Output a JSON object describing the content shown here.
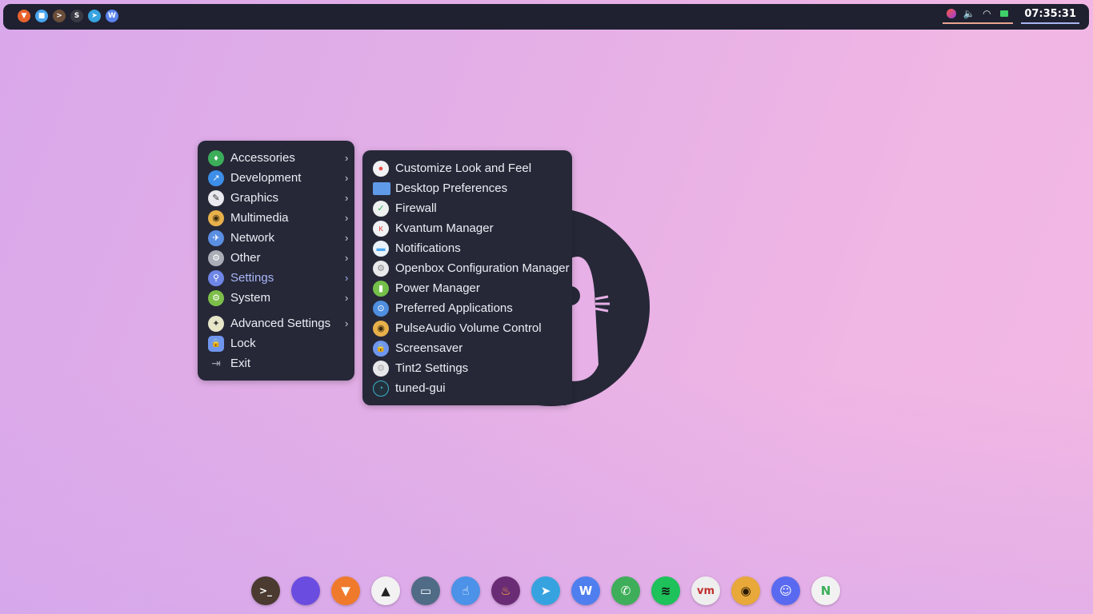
{
  "topbar": {
    "launchers": [
      {
        "name": "brave-icon",
        "color": "#e8622c",
        "glyph": "▼"
      },
      {
        "name": "files-icon",
        "color": "#4aa6ee",
        "glyph": "■"
      },
      {
        "name": "terminal-icon",
        "color": "#6b4e3a",
        "glyph": ">"
      },
      {
        "name": "sublime-icon",
        "color": "#3a3a44",
        "glyph": "S"
      },
      {
        "name": "telegram-icon",
        "color": "#36a3e0",
        "glyph": "➤"
      },
      {
        "name": "wps-icon",
        "color": "#5a84ee",
        "glyph": "W"
      }
    ],
    "tray_icons": [
      "app-tray-icon",
      "volume-icon",
      "wifi-icon",
      "battery-icon"
    ],
    "clock": "07:35:31"
  },
  "main_menu": {
    "items": [
      {
        "label": "Accessories",
        "icon": "accessories-icon",
        "color": "#3cae5a",
        "glyph": "♦",
        "submenu": true
      },
      {
        "label": "Development",
        "icon": "development-icon",
        "color": "#3d8ee8",
        "glyph": "↗",
        "submenu": true
      },
      {
        "label": "Graphics",
        "icon": "graphics-icon",
        "color": "#e9e9ef",
        "glyph": "✎",
        "submenu": true
      },
      {
        "label": "Multimedia",
        "icon": "multimedia-icon",
        "color": "#e8b04a",
        "glyph": "◉",
        "submenu": true
      },
      {
        "label": "Network",
        "icon": "network-icon",
        "color": "#5a8fe2",
        "glyph": "✈",
        "submenu": true
      },
      {
        "label": "Other",
        "icon": "other-icon",
        "color": "#a9adb6",
        "glyph": "⚙",
        "submenu": true
      },
      {
        "label": "Settings",
        "icon": "settings-icon",
        "color": "#6f86e8",
        "glyph": "⚲",
        "submenu": true,
        "active": true
      },
      {
        "label": "System",
        "icon": "system-icon",
        "color": "#7dbe4a",
        "glyph": "⚙",
        "submenu": true
      },
      {
        "label": "Advanced Settings",
        "icon": "advanced-settings-icon",
        "color": "#e7e6c9",
        "glyph": "✦",
        "submenu": true
      },
      {
        "label": "Lock",
        "icon": "lock-icon",
        "color": "#6f96ee",
        "glyph": "🔒",
        "submenu": false
      },
      {
        "label": "Exit",
        "icon": "exit-icon",
        "color": "transparent",
        "glyph": "⇥",
        "submenu": false
      }
    ]
  },
  "settings_menu": {
    "items": [
      {
        "label": "Customize Look and Feel",
        "icon": "customize-look-icon",
        "color": "#f2f2f4",
        "glyph": "●"
      },
      {
        "label": "Desktop Preferences",
        "icon": "desktop-preferences-icon",
        "color": "#5f9ae8",
        "glyph": ""
      },
      {
        "label": "Firewall",
        "icon": "firewall-icon",
        "color": "#eef0f0",
        "glyph": "✓"
      },
      {
        "label": "Kvantum Manager",
        "icon": "kvantum-icon",
        "color": "#f2f2f4",
        "glyph": "κ"
      },
      {
        "label": "Notifications",
        "icon": "notifications-icon",
        "color": "#eaf2fa",
        "glyph": "▬"
      },
      {
        "label": "Openbox Configuration Manager",
        "icon": "openbox-icon",
        "color": "#e9e9ec",
        "glyph": "⚙"
      },
      {
        "label": "Power Manager",
        "icon": "power-manager-icon",
        "color": "#74c04a",
        "glyph": "▮"
      },
      {
        "label": "Preferred Applications",
        "icon": "preferred-apps-icon",
        "color": "#4f8fe0",
        "glyph": "⊙"
      },
      {
        "label": "PulseAudio Volume Control",
        "icon": "pulseaudio-icon",
        "color": "#e8b04a",
        "glyph": "◉"
      },
      {
        "label": "Screensaver",
        "icon": "screensaver-icon",
        "color": "#6f96ee",
        "glyph": "🔒"
      },
      {
        "label": "Tint2 Settings",
        "icon": "tint2-icon",
        "color": "#e7e7ea",
        "glyph": "⚙"
      },
      {
        "label": "tuned-gui",
        "icon": "tuned-gui-icon",
        "color": "#23303c",
        "glyph": "◔"
      }
    ]
  },
  "dock": {
    "items": [
      {
        "name": "terminal-dock-icon",
        "color": "#4a3a30",
        "glyph": ">_"
      },
      {
        "name": "files-dock-icon",
        "color": "#6a4ce0",
        "glyph": ""
      },
      {
        "name": "brave-dock-icon",
        "color": "#f07a2c",
        "glyph": "▼"
      },
      {
        "name": "inkscape-dock-icon",
        "color": "#f2f2f2",
        "glyph": "▲"
      },
      {
        "name": "virtual-machine-dock-icon",
        "color": "#4f6b86",
        "glyph": "▭"
      },
      {
        "name": "touch-dock-icon",
        "color": "#4b92e8",
        "glyph": "☝"
      },
      {
        "name": "firefox-dock-icon",
        "color": "#6a2c74",
        "glyph": "♨"
      },
      {
        "name": "telegram-dock-icon",
        "color": "#36a3e0",
        "glyph": "➤"
      },
      {
        "name": "wps-dock-icon",
        "color": "#4f7fee",
        "glyph": "W"
      },
      {
        "name": "whatsapp-dock-icon",
        "color": "#3fae5a",
        "glyph": "✆"
      },
      {
        "name": "spotify-dock-icon",
        "color": "#1ec15a",
        "glyph": "≋"
      },
      {
        "name": "vmware-dock-icon",
        "color": "#eeeeee",
        "glyph": "vm"
      },
      {
        "name": "audio-dock-icon",
        "color": "#e8a83a",
        "glyph": "◉"
      },
      {
        "name": "discord-dock-icon",
        "color": "#5a6af0",
        "glyph": "☺"
      },
      {
        "name": "neovim-dock-icon",
        "color": "#f2f2f2",
        "glyph": "N"
      }
    ]
  }
}
